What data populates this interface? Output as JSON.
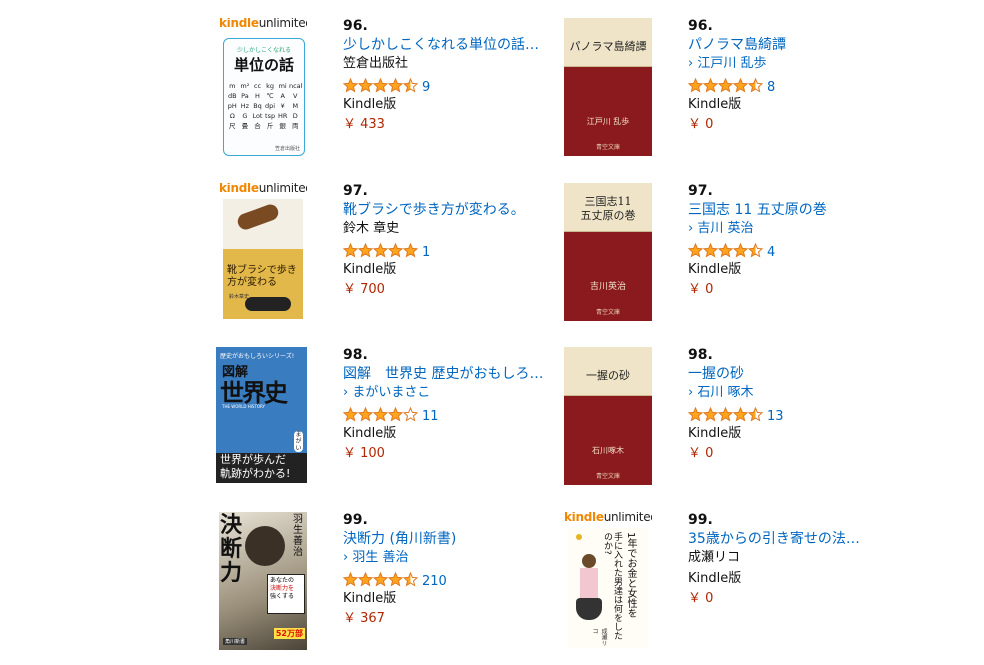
{
  "logo": {
    "kindle": "kindle",
    "unlimited": "unlimited"
  },
  "items": [
    {
      "rank": "96.",
      "title": "少しかしこくなれる単位の話…",
      "author": "笠倉出版社",
      "author_link": false,
      "stars": 4.5,
      "reviews": "9",
      "format": "Kindle版",
      "price": "￥ 433"
    },
    {
      "rank": "96.",
      "title": "パノラマ島綺譚",
      "author": "› 江戸川 乱歩",
      "author_link": true,
      "stars": 4.5,
      "reviews": "8",
      "format": "Kindle版",
      "price": "￥ 0"
    },
    {
      "rank": "97.",
      "title": "靴ブラシで歩き方が変わる。",
      "author": "鈴木 章史",
      "author_link": false,
      "stars": 5,
      "reviews": "1",
      "format": "Kindle版",
      "price": "￥ 700"
    },
    {
      "rank": "97.",
      "title": "三国志 11 五丈原の巻",
      "author": "› 吉川 英治",
      "author_link": true,
      "stars": 4.5,
      "reviews": "4",
      "format": "Kindle版",
      "price": "￥ 0"
    },
    {
      "rank": "98.",
      "title": "図解　世界史 歴史がおもしろ…",
      "author": "› まがいまさこ",
      "author_link": true,
      "stars": 4,
      "reviews": "11",
      "format": "Kindle版",
      "price": "￥ 100"
    },
    {
      "rank": "98.",
      "title": "一握の砂",
      "author": "› 石川 啄木",
      "author_link": true,
      "stars": 4.5,
      "reviews": "13",
      "format": "Kindle版",
      "price": "￥ 0"
    },
    {
      "rank": "99.",
      "title": "決断力 (角川新書)",
      "author": "› 羽生 善治",
      "author_link": true,
      "stars": 4.5,
      "reviews": "210",
      "format": "Kindle版",
      "price": "￥ 367"
    },
    {
      "rank": "99.",
      "title": "35歳からの引き寄せの法…",
      "author": "成瀬リコ",
      "author_link": false,
      "stars": 0,
      "reviews": "",
      "format": "Kindle版",
      "price": "￥ 0"
    }
  ],
  "covers": {
    "c1": {
      "head": "少しかしこくなれる",
      "main": "単位の話",
      "units": [
        "m",
        "m²",
        "cc",
        "kg",
        "mi",
        "ncal",
        "dB",
        "Pa",
        "H",
        "℃",
        "A",
        "V",
        "pH",
        "Hz",
        "Bq",
        "dpi",
        "¥",
        "M",
        "Ω",
        "G",
        "Lot",
        "tsp",
        "HR",
        "D",
        "尺",
        "畳",
        "合",
        "斤",
        "銀",
        "両"
      ],
      "pub": "笠倉出版社"
    },
    "c2": {
      "title": "パノラマ島綺譚",
      "author": "江戸川 乱歩",
      "pub": "青空文庫"
    },
    "c3": {
      "title": "靴ブラシで歩き方が変わる",
      "author": "鈴木章史"
    },
    "c4": {
      "title1": "三国志11",
      "title2": "五丈原の巻",
      "author": "吉川英治",
      "pub": "青空文庫"
    },
    "c5": {
      "series": "歴史がおもしろいシリーズ!",
      "t1": "図解",
      "t2": "世界史",
      "sub": "THE WORLD HISTORY",
      "side": "まがい",
      "band1": "世界が歩んだ",
      "band2": "軌跡がわかる!"
    },
    "c6": {
      "title": "一握の砂",
      "author": "石川啄木",
      "pub": "青空文庫"
    },
    "c7": {
      "title": "決断力",
      "author": "羽生善治",
      "blurb1": "あなたの",
      "blurb2": "決断力を",
      "blurb3": "強くする",
      "badge": "52万部",
      "pub": "角川新書"
    },
    "c8": {
      "vt": "1年でお金と女性を",
      "vt2": "手に入れた男達は何をしたのか?",
      "author": "成瀬リコ"
    }
  },
  "colors": {
    "link": "#0066c0",
    "price": "#b12704",
    "star": "#ffa41c",
    "aozora_red": "#8b1a1e"
  }
}
